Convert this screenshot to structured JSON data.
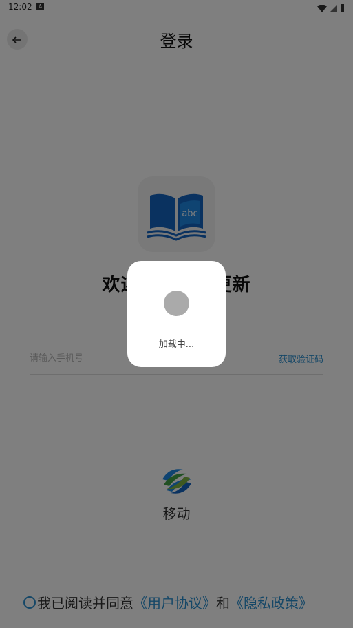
{
  "status_bar": {
    "time": "12:02",
    "notification_icon": "A"
  },
  "header": {
    "title": "登录",
    "back_icon": "arrow-left-icon"
  },
  "welcome": {
    "text": "欢迎使用登录更新"
  },
  "login_form": {
    "phone_placeholder": "请输入手机号",
    "get_code_label": "获取验证码"
  },
  "carrier": {
    "name": "移动"
  },
  "agreement": {
    "prefix": "我已阅读并同意",
    "user_agreement": "《用户协议》",
    "conjunction": "和",
    "privacy_policy": "《隐私政策》"
  },
  "loading": {
    "text": "加载中..."
  },
  "colors": {
    "accent": "#2b8fcf",
    "logo_blue": "#1565c0",
    "overlay": "rgba(0,0,0,0.5)"
  }
}
